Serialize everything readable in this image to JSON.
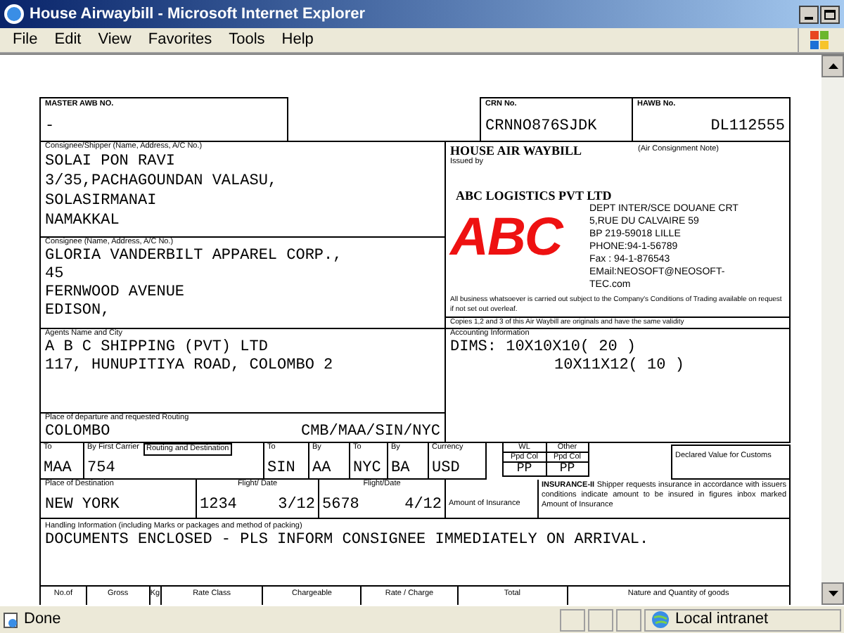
{
  "window": {
    "title": "House Airwaybill - Microsoft Internet Explorer"
  },
  "menu": [
    "File",
    "Edit",
    "View",
    "Favorites",
    "Tools",
    "Help"
  ],
  "form": {
    "master_awb": {
      "label": "MASTER AWB NO.",
      "value": "-"
    },
    "crn": {
      "label": "CRN No.",
      "value": "CRNNO876SJDK"
    },
    "hawb": {
      "label": "HAWB No.",
      "value": "DL112555"
    },
    "shipper": {
      "label": "Consignee/Shipper (Name, Address, A/C No.)",
      "lines": [
        "SOLAI PON RAVI",
        "3/35,PACHAGOUNDAN VALASU,",
        "SOLASIRMANAI",
        "NAMAKKAL"
      ]
    },
    "consignee": {
      "label": "Consignee (Name, Address, A/C No.)",
      "lines": [
        "GLORIA VANDERBILT APPAREL CORP.,",
        "45",
        "FERNWOOD AVENUE",
        "EDISON,"
      ]
    },
    "agent": {
      "label": "Agents Name and City",
      "lines": [
        "A B C SHIPPING (PVT) LTD",
        "117, HUNUPITIYA ROAD, COLOMBO 2"
      ]
    },
    "departure": {
      "label": "Place of departure and requested Routing",
      "value": "COLOMBO",
      "routing": "CMB/MAA/SIN/NYC"
    },
    "issuer": {
      "title": "HOUSE AIR WAYBILL",
      "note": "(Air Consignment Note)",
      "issued_by": "Issued by",
      "company": "ABC LOGISTICS PVT LTD",
      "logo": "ABC",
      "address": [
        "DEPT INTER/SCE DOUANE CRT",
        "5,RUE DU CALVAIRE 59",
        "BP 219-59018 LILLE",
        "PHONE:94-1-56789",
        "Fax : 94-1-876543",
        "EMail:NEOSOFT@NEOSOFT-",
        "TEC.com"
      ],
      "terms": "All business whatsoever is carried out subject to the Company's Conditions of Trading available on request if not set out overleaf.",
      "copies": "Copies 1,2 and 3 of this Air Waybill are originals and have the same validity"
    },
    "accounting": {
      "label": "Accounting Information",
      "lines": [
        "DIMS: 10X10X10( 20 )",
        "10X11X12( 10 )"
      ]
    },
    "routing_row": [
      {
        "label": "To",
        "value": "MAA"
      },
      {
        "label": "By First Carrier",
        "sub_label": "Routing and Destination",
        "value": "754"
      },
      {
        "label": "To",
        "value": "SIN"
      },
      {
        "label": "By",
        "value": "AA"
      },
      {
        "label": "To",
        "value": "NYC"
      },
      {
        "label": "By",
        "value": "BA"
      },
      {
        "label": "Currency",
        "value": "USD"
      }
    ],
    "charges": [
      {
        "label": "WL",
        "sub_label": "Ppd Col",
        "value": "PP"
      },
      {
        "label": "Other",
        "sub_label": "Ppd Col",
        "value": "PP"
      }
    ],
    "declared_value": {
      "label": "Declared Value for Customs"
    },
    "destination": {
      "label": "Place of Destination",
      "value": "NEW YORK"
    },
    "flights": [
      {
        "label": "Flight/ Date",
        "flight": "1234",
        "date": "3/12"
      },
      {
        "label": "Flight/Date",
        "flight": "5678",
        "date": "4/12"
      }
    ],
    "amount_of_insurance": {
      "label": "Amount of Insurance"
    },
    "insurance": "**INSURANCE-II** Shipper requests insurance in accordance with issuers conditions indicate amount to be insured in figures inbox marked Amount of Insurance",
    "handling": {
      "label": "Handling Information (including Marks or packages and method of packing)",
      "value": "DOCUMENTS ENCLOSED - PLS INFORM CONSIGNEE IMMEDIATELY ON ARRIVAL."
    },
    "goods_columns": [
      "No.of",
      "Gross",
      "Kg",
      "Rate Class",
      "Chargeable",
      "Rate / Charge",
      "Total",
      "Nature and Quantity of goods"
    ]
  },
  "status_bar": {
    "text": "Done",
    "zone": "Local intranet"
  }
}
